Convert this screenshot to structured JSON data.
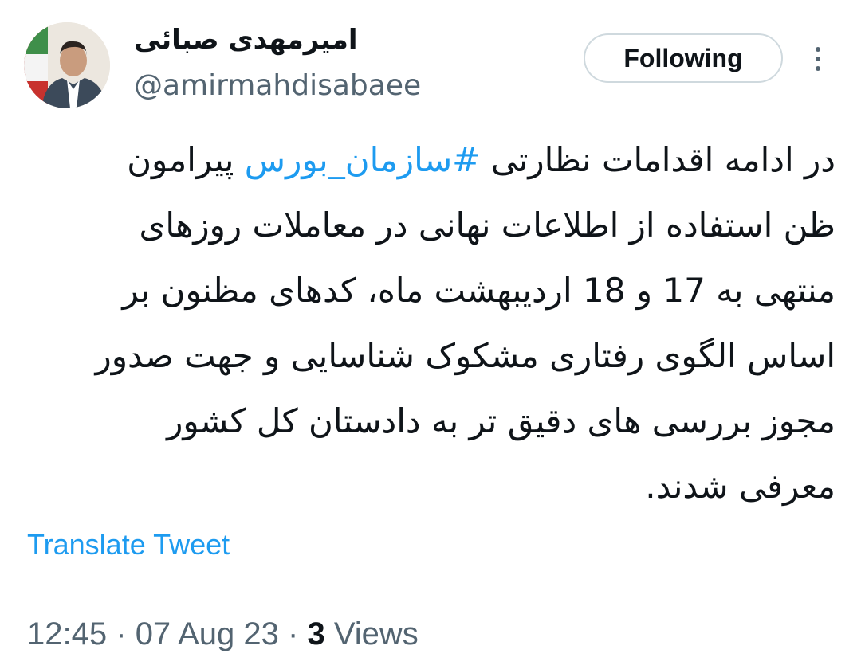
{
  "user": {
    "display_name": "امیرمهدی صبائی",
    "handle": "@amirmahdisabaee"
  },
  "follow_button": {
    "label": "Following"
  },
  "more_icon": "more-vertical-icon",
  "tweet": {
    "lines": [
      {
        "pre": "در ادامه اقدامات نظارتی ",
        "hashtag": "#سازمان_بورس",
        "post": " پیرامون"
      },
      {
        "text": "ظن استفاده از اطلاعات نهانی در معاملات روزهای"
      },
      {
        "text": "منتهی به 17 و 18 اردیبهشت ماه، کدهای مظنون بر"
      },
      {
        "text": "اساس الگوی رفتاری مشکوک شناسایی و جهت صدور"
      },
      {
        "text": "مجوز بررسی های دقیق تر به دادستان کل کشور"
      },
      {
        "text": "معرفی شدند."
      }
    ]
  },
  "translate_label": "Translate Tweet",
  "meta": {
    "time": "12:45",
    "separator": "·",
    "date": "07 Aug 23",
    "views_count": "3",
    "views_label": "Views"
  },
  "colors": {
    "link": "#1d9bf0",
    "secondary_text": "#536471",
    "primary_text": "#0f1419",
    "button_border": "#cfd9de"
  }
}
